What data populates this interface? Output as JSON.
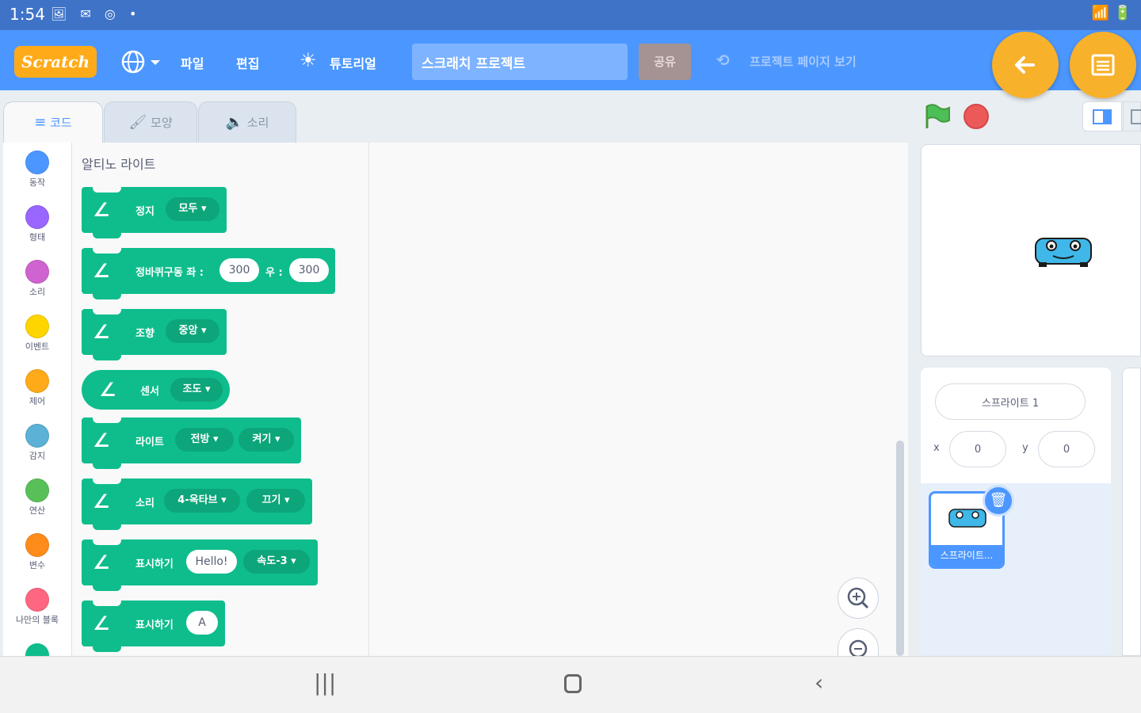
{
  "status": {
    "time": "1:54",
    "icons_left": "🖼 ✉ ◎ •",
    "icons_right": "📶 🔋"
  },
  "menu": {
    "logo": "Scratch",
    "globe_icon": "globe-icon",
    "file": "파일",
    "edit": "편집",
    "tutorial": "튜토리얼",
    "project_title_value": "스크래치 프로젝트",
    "share": "공유",
    "see_project_page": "프로젝트 페이지 보기"
  },
  "tabs": {
    "code": "코드",
    "costumes": "모양",
    "sounds": "소리"
  },
  "categories": [
    {
      "label": "동작",
      "color": "#4c97ff"
    },
    {
      "label": "형태",
      "color": "#9966ff"
    },
    {
      "label": "소리",
      "color": "#cf63cf"
    },
    {
      "label": "이벤트",
      "color": "#ffd500"
    },
    {
      "label": "제어",
      "color": "#ffab19"
    },
    {
      "label": "감지",
      "color": "#5cb1d6"
    },
    {
      "label": "연산",
      "color": "#59c059"
    },
    {
      "label": "변수",
      "color": "#ff8c1a"
    },
    {
      "label": "나만의 블록",
      "color": "#ff6680"
    }
  ],
  "palette": {
    "title": "알티노 라이트",
    "blocks": [
      {
        "text": "정지",
        "drop1": "모두"
      },
      {
        "text": "정바퀴구동 좌 :",
        "val1": "300",
        "text2": "우 :",
        "val2": "300"
      },
      {
        "text": "조향",
        "drop1": "중앙"
      },
      {
        "text": "센서",
        "drop1": "조도"
      },
      {
        "text": "라이트",
        "drop1": "전방",
        "drop2": "켜기"
      },
      {
        "text": "소리",
        "drop1": "4-옥타브",
        "drop2": "끄기"
      },
      {
        "text": "표시하기",
        "val1": "Hello!",
        "drop1": "속도-3"
      },
      {
        "text": "표시하기",
        "val1": "A"
      }
    ]
  },
  "sprite": {
    "name_value": "스프라이트 1",
    "x_label": "x",
    "x_value": "0",
    "y_label": "y",
    "y_value": "0",
    "thumb_label": "스프라이트..."
  },
  "colors": {
    "accent": "#4c97ff",
    "block": "#0fbd8c",
    "fab": "#f8b12b"
  }
}
